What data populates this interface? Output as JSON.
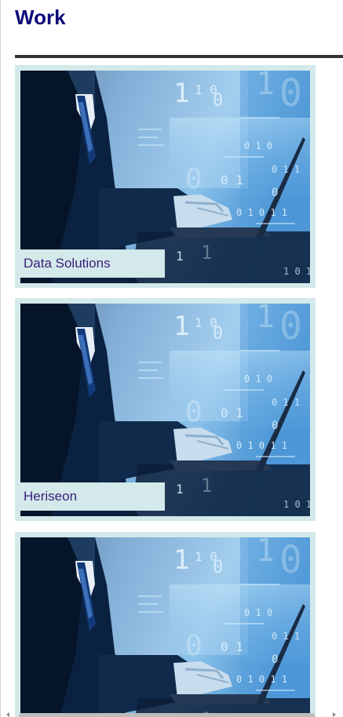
{
  "page": {
    "title": "Work"
  },
  "cards": [
    {
      "caption": "Data Solutions",
      "image": "businessman-typing-laptop-data-overlay"
    },
    {
      "caption": "Heriseon",
      "image": "businessman-typing-laptop-data-overlay"
    },
    {
      "caption": "",
      "image": "businessman-typing-laptop-data-overlay"
    }
  ],
  "colors": {
    "title": "#0c0a7a",
    "caption_text": "#3a1f7a",
    "card_background": "#d3e9ea",
    "divider": "#333333"
  }
}
